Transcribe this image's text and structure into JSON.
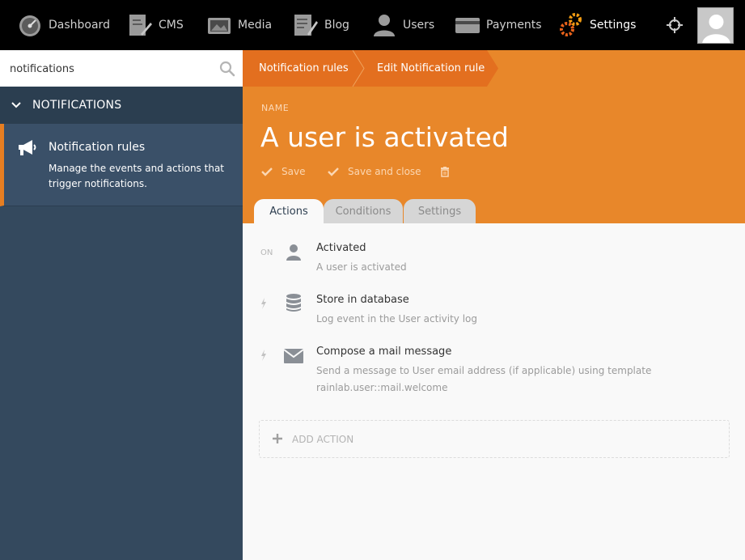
{
  "nav": {
    "items": [
      {
        "label": "Dashboard",
        "icon": "dashboard-icon"
      },
      {
        "label": "CMS",
        "icon": "cms-icon"
      },
      {
        "label": "Media",
        "icon": "media-icon"
      },
      {
        "label": "Blog",
        "icon": "blog-icon"
      },
      {
        "label": "Users",
        "icon": "users-icon"
      },
      {
        "label": "Payments",
        "icon": "payments-icon"
      },
      {
        "label": "Settings",
        "icon": "settings-icon",
        "active": true
      }
    ]
  },
  "sidebar": {
    "search_value": "notifications",
    "group_label": "NOTIFICATIONS",
    "item": {
      "title": "Notification rules",
      "description": "Manage the events and actions that trigger notifications."
    }
  },
  "breadcrumb": {
    "items": [
      "Notification rules",
      "Edit Notification rule"
    ]
  },
  "form": {
    "name_label": "NAME",
    "title": "A user is activated",
    "save_label": "Save",
    "save_close_label": "Save and close"
  },
  "tabs": [
    "Actions",
    "Conditions",
    "Settings"
  ],
  "rows": [
    {
      "prefix": "ON",
      "icon": "user-icon",
      "title": "Activated",
      "description": "A user is activated"
    },
    {
      "prefix": "",
      "icon": "database-icon",
      "title": "Store in database",
      "description": "Log event in the User activity log"
    },
    {
      "prefix": "",
      "icon": "envelope-icon",
      "title": "Compose a mail message",
      "description": "Send a message to User email address (if applicable) using template rainlab.user::mail.welcome"
    }
  ],
  "add_action_label": "ADD ACTION",
  "colors": {
    "accent": "#e8872a",
    "sidebar": "#34495e",
    "topbar": "#000000"
  }
}
